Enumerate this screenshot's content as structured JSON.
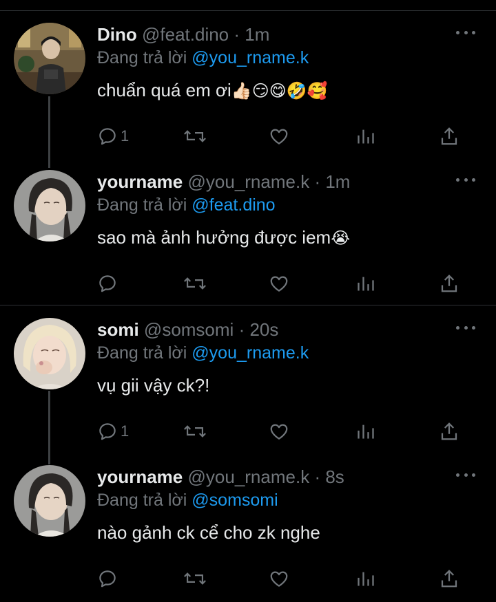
{
  "tweets": [
    {
      "name": "Dino",
      "handle": "@feat.dino",
      "time": "1m",
      "replying_label": "Đang trả lời",
      "mention": "@you_rname.k",
      "text": "chuẩn quá em ơi",
      "emoji": "👍🏻😏😋🤣🥰",
      "reply_count": "1",
      "icons": [
        "reply-icon",
        "retweet-icon",
        "like-icon",
        "analytics-icon",
        "share-icon"
      ]
    },
    {
      "name": "yourname",
      "handle": "@you_rname.k",
      "time": "1m",
      "replying_label": "Đang trả lời",
      "mention": "@feat.dino",
      "text": "sao mà ảnh hưởng được iem",
      "emoji": "😭",
      "reply_count": "",
      "icons": [
        "reply-icon",
        "retweet-icon",
        "like-icon",
        "analytics-icon",
        "share-icon"
      ]
    },
    {
      "name": "somi",
      "handle": "@somsomi",
      "time": "20s",
      "replying_label": "Đang trả lời",
      "mention": "@you_rname.k",
      "text": "vụ gii vậy ck?!",
      "emoji": "",
      "reply_count": "1",
      "icons": [
        "reply-icon",
        "retweet-icon",
        "like-icon",
        "analytics-icon",
        "share-icon"
      ]
    },
    {
      "name": "yourname",
      "handle": "@you_rname.k",
      "time": "8s",
      "replying_label": "Đang trả lời",
      "mention": "@somsomi",
      "text": "nào gảnh ck cể cho zk nghe",
      "emoji": "",
      "reply_count": "",
      "icons": [
        "reply-icon",
        "retweet-icon",
        "like-icon",
        "analytics-icon",
        "share-icon"
      ]
    }
  ],
  "separator": "·",
  "colors": {
    "background": "#000000",
    "text": "#e7e9ea",
    "secondary": "#71767b",
    "mention": "#1d9bf0",
    "divider": "#2f3336"
  }
}
